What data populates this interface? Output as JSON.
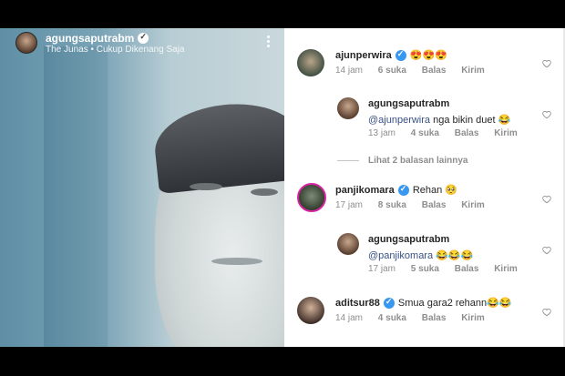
{
  "video": {
    "username": "agungsaputrabm",
    "song": "The Junas • Cukup Dikenang Saja"
  },
  "comments": [
    {
      "user": "ajunperwira",
      "text": "😍😍😍",
      "time": "14 jam",
      "likes": "6 suka",
      "reply": "Balas",
      "send": "Kirim"
    },
    {
      "user": "agungsaputrabm",
      "mention": "@ajunperwira",
      "text": " nga bikin duet 😂",
      "time": "13 jam",
      "likes": "4 suka",
      "reply": "Balas",
      "send": "Kirim"
    },
    {
      "view_more": "Lihat 2 balasan lainnya"
    },
    {
      "user": "panjikomara",
      "text": "Rehan 🥺",
      "time": "17 jam",
      "likes": "8 suka",
      "reply": "Balas",
      "send": "Kirim"
    },
    {
      "user": "agungsaputrabm",
      "mention": "@panjikomara",
      "text": " 😂😂😂",
      "time": "17 jam",
      "likes": "5 suka",
      "reply": "Balas",
      "send": "Kirim"
    },
    {
      "user": "aditsur88",
      "text": "Smua gara2 rehann😂😂",
      "time": "14 jam",
      "likes": "4 suka",
      "reply": "Balas",
      "send": "Kirim"
    }
  ]
}
